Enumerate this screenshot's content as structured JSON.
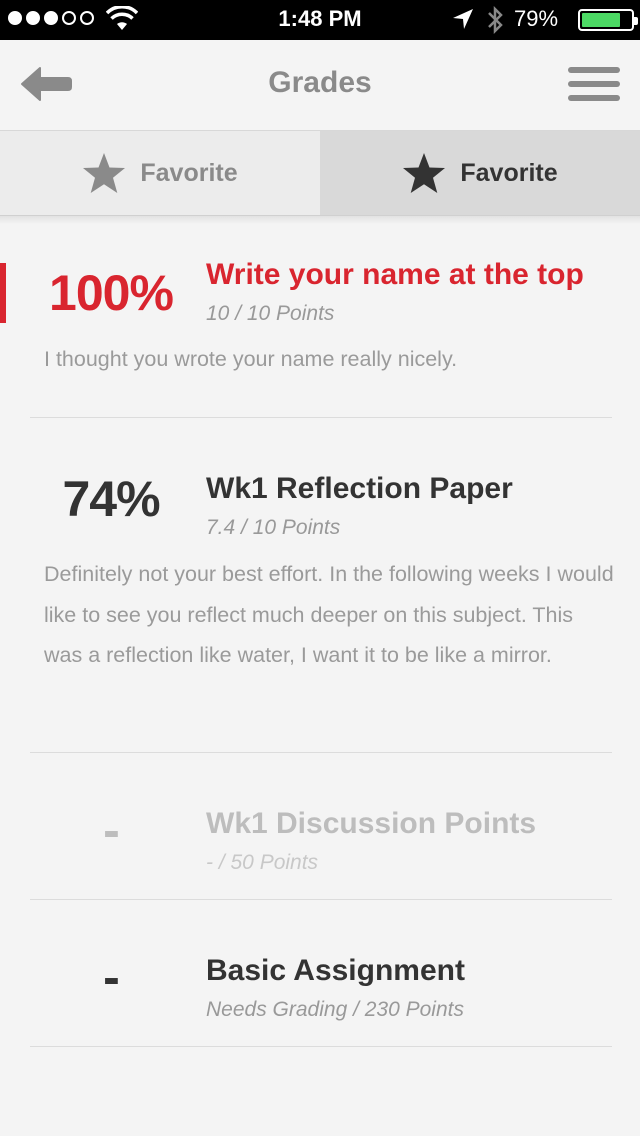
{
  "status_bar": {
    "signal_dots_filled": 3,
    "signal_dots_total": 5,
    "time": "1:48 PM",
    "battery_percent": "79%",
    "battery_level": 0.79,
    "battery_color": "#4cd964"
  },
  "nav": {
    "title": "Grades",
    "back_icon": "arrow-left-icon",
    "menu_icon": "hamburger-menu-icon"
  },
  "tabs": [
    {
      "label": "Favorite",
      "icon": "star-icon",
      "active": false
    },
    {
      "label": "Favorite",
      "icon": "star-icon",
      "active": true
    }
  ],
  "colors": {
    "accent_red": "#d9252f",
    "text_dark": "#333333",
    "text_muted": "#bdbdbd"
  },
  "grades": [
    {
      "score": "100%",
      "title": "Write your name at the top",
      "points": "10 / 10 Points",
      "comment": "I thought you wrote your name really nicely.",
      "highlighted": true
    },
    {
      "score": "74%",
      "title": "Wk1 Reflection Paper",
      "points": "7.4 / 10 Points",
      "comment": "Definitely not your best effort. In the following weeks I would like to see you reflect much deeper on this subject. This was a reflection like water, I want it to be like a mirror.",
      "highlighted": false
    },
    {
      "score": "-",
      "title": "Wk1 Discussion Points",
      "points": "- / 50 Points",
      "comment": "",
      "muted": true
    },
    {
      "score": "-",
      "title": "Basic Assignment",
      "points": "Needs Grading / 230 Points",
      "comment": "",
      "muted": false
    }
  ]
}
